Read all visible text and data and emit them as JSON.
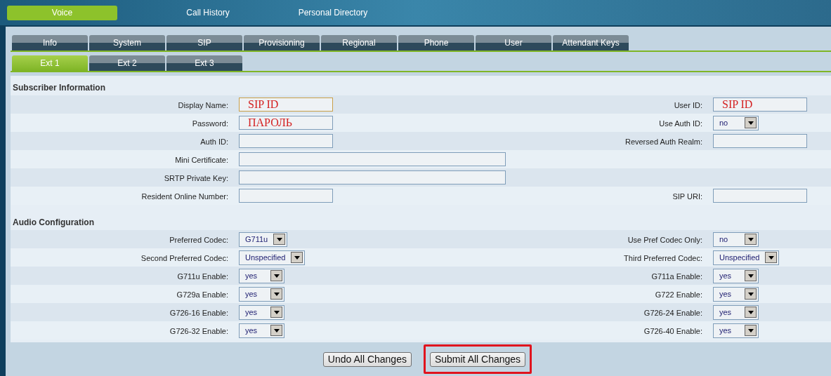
{
  "top_nav": [
    {
      "label": "Voice",
      "selected": true
    },
    {
      "label": "Call History",
      "selected": false
    },
    {
      "label": "Personal Directory",
      "selected": false
    }
  ],
  "tabs": [
    {
      "label": "Info",
      "selected": false
    },
    {
      "label": "System",
      "selected": false
    },
    {
      "label": "SIP",
      "selected": false
    },
    {
      "label": "Provisioning",
      "selected": false
    },
    {
      "label": "Regional",
      "selected": false
    },
    {
      "label": "Phone",
      "selected": false
    },
    {
      "label": "User",
      "selected": false
    },
    {
      "label": "Attendant Keys",
      "selected": false
    }
  ],
  "ext_tabs": [
    {
      "label": "Ext 1",
      "selected": true
    },
    {
      "label": "Ext 2",
      "selected": false
    },
    {
      "label": "Ext 3",
      "selected": false
    }
  ],
  "sections": [
    {
      "title": "Subscriber Information",
      "rows": [
        {
          "left": {
            "label": "Display Name:",
            "kind": "text",
            "value": "SIP ID",
            "focused": true
          },
          "right": {
            "label": "User ID:",
            "kind": "text",
            "value": "SIP ID"
          }
        },
        {
          "left": {
            "label": "Password:",
            "kind": "text",
            "value": "ПАРОЛЬ"
          },
          "right": {
            "label": "Use Auth ID:",
            "kind": "select",
            "value": "no"
          }
        },
        {
          "left": {
            "label": "Auth ID:",
            "kind": "text"
          },
          "right": {
            "label": "Reversed Auth Realm:",
            "kind": "text"
          }
        },
        {
          "left": {
            "label": "Mini Certificate:",
            "kind": "wide"
          }
        },
        {
          "left": {
            "label": "SRTP Private Key:",
            "kind": "wide"
          }
        },
        {
          "left": {
            "label": "Resident Online Number:",
            "kind": "text"
          },
          "right": {
            "label": "SIP URI:",
            "kind": "text"
          }
        }
      ]
    },
    {
      "title": "Audio Configuration",
      "rows": [
        {
          "left": {
            "label": "Preferred Codec:",
            "kind": "select",
            "value": "G711u"
          },
          "right": {
            "label": "Use Pref Codec Only:",
            "kind": "select",
            "value": "no"
          }
        },
        {
          "left": {
            "label": "Second Preferred Codec:",
            "kind": "select",
            "value": "Unspecified"
          },
          "right": {
            "label": "Third Preferred Codec:",
            "kind": "select",
            "value": "Unspecified"
          }
        },
        {
          "left": {
            "label": "G711u Enable:",
            "kind": "select",
            "value": "yes"
          },
          "right": {
            "label": "G711a Enable:",
            "kind": "select",
            "value": "yes"
          }
        },
        {
          "left": {
            "label": "G729a Enable:",
            "kind": "select",
            "value": "yes"
          },
          "right": {
            "label": "G722 Enable:",
            "kind": "select",
            "value": "yes"
          }
        },
        {
          "left": {
            "label": "G726-16 Enable:",
            "kind": "select",
            "value": "yes"
          },
          "right": {
            "label": "G726-24 Enable:",
            "kind": "select",
            "value": "yes"
          }
        },
        {
          "left": {
            "label": "G726-32 Enable:",
            "kind": "select",
            "value": "yes"
          },
          "right": {
            "label": "G726-40 Enable:",
            "kind": "select",
            "value": "yes"
          }
        }
      ]
    }
  ],
  "buttons": [
    {
      "label": "Undo All Changes",
      "highlighted": false
    },
    {
      "label": "Submit All Changes",
      "highlighted": true
    }
  ]
}
